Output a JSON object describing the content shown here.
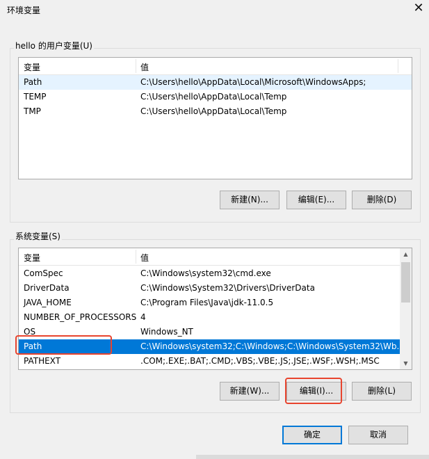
{
  "window": {
    "title": "环境变量"
  },
  "user_group": {
    "legend": "hello 的用户变量(U)",
    "columns": [
      "变量",
      "值"
    ],
    "rows": [
      {
        "name": "Path",
        "value": "C:\\Users\\hello\\AppData\\Local\\Microsoft\\WindowsApps;"
      },
      {
        "name": "TEMP",
        "value": "C:\\Users\\hello\\AppData\\Local\\Temp"
      },
      {
        "name": "TMP",
        "value": "C:\\Users\\hello\\AppData\\Local\\Temp"
      }
    ],
    "buttons": {
      "new": "新建(N)...",
      "edit": "编辑(E)...",
      "delete": "删除(D)"
    }
  },
  "system_group": {
    "legend": "系统变量(S)",
    "columns": [
      "变量",
      "值"
    ],
    "rows": [
      {
        "name": "ComSpec",
        "value": "C:\\Windows\\system32\\cmd.exe"
      },
      {
        "name": "DriverData",
        "value": "C:\\Windows\\System32\\Drivers\\DriverData"
      },
      {
        "name": "JAVA_HOME",
        "value": "C:\\Program Files\\Java\\jdk-11.0.5"
      },
      {
        "name": "NUMBER_OF_PROCESSORS",
        "value": "4"
      },
      {
        "name": "OS",
        "value": "Windows_NT"
      },
      {
        "name": "Path",
        "value": "C:\\Windows\\system32;C:\\Windows;C:\\Windows\\System32\\Wb..."
      },
      {
        "name": "PATHEXT",
        "value": ".COM;.EXE;.BAT;.CMD;.VBS;.VBE;.JS;.JSE;.WSF;.WSH;.MSC"
      }
    ],
    "buttons": {
      "new": "新建(W)...",
      "edit": "编辑(I)...",
      "delete": "删除(L)"
    }
  },
  "footer": {
    "ok": "确定",
    "cancel": "取消"
  },
  "icons": {
    "close": "close-icon",
    "scroll_up": "scroll-up-arrow",
    "scroll_down": "scroll-down-arrow"
  },
  "colors": {
    "selection": "#0078d7",
    "highlight_annotation": "#e8442e",
    "hover_row": "#e5f3ff"
  }
}
